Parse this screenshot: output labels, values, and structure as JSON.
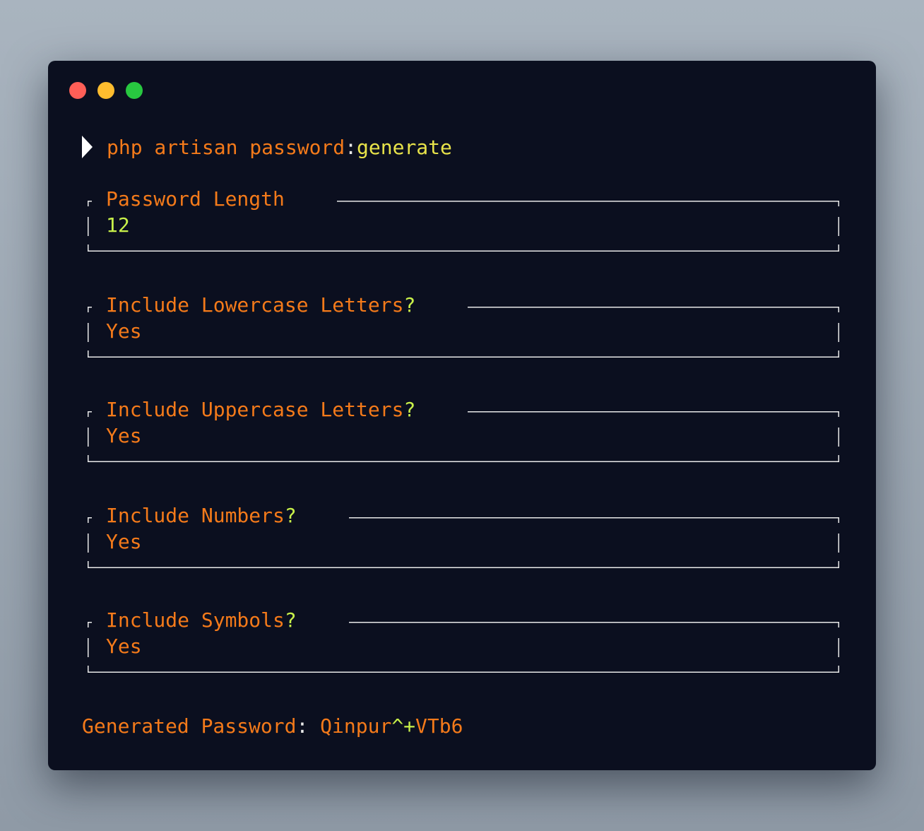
{
  "command": {
    "part1": "php artisan password",
    "separator": ":",
    "part2": "generate"
  },
  "prompts": [
    {
      "label": "Password Length",
      "value": "12"
    },
    {
      "label": "Include Lowercase Letters",
      "value": "Yes"
    },
    {
      "label": "Include Uppercase Letters",
      "value": "Yes"
    },
    {
      "label": "Include Numbers",
      "value": "Yes"
    },
    {
      "label": "Include Symbols",
      "value": "Yes"
    }
  ],
  "result": {
    "label": "Generated Password",
    "separator": ": ",
    "password_part1": "Qinpur",
    "password_part2": "^+",
    "password_part3": "VTb6"
  },
  "colors": {
    "background": "#0b0f1f",
    "accent_orange": "#f47a1a",
    "accent_yellow": "#e8e34a",
    "accent_lime": "#c8f04a",
    "border": "#e8e8e8",
    "traffic_red": "#ff5f57",
    "traffic_yellow": "#febc2e",
    "traffic_green": "#28c840"
  }
}
